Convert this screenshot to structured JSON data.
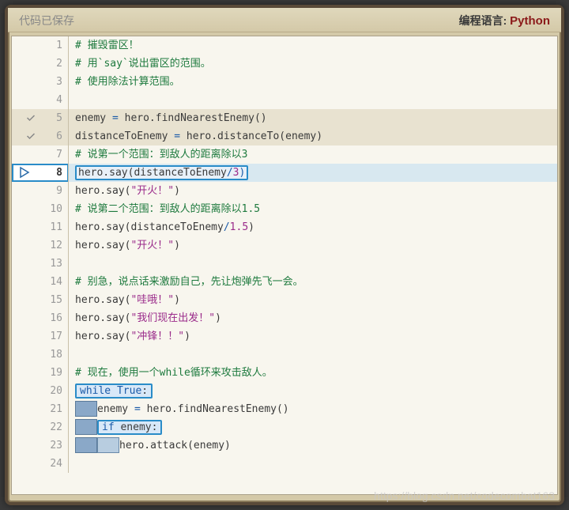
{
  "header": {
    "save_status": "代码已保存",
    "lang_label": "编程语言: ",
    "lang_value": "Python"
  },
  "lines": {
    "l1": "# 摧毁雷区！",
    "l2": "# 用`say`说出雷区的范围。",
    "l3": "# 使用除法计算范围。",
    "l5_a": "enemy ",
    "l5_b": "=",
    "l5_c": " hero.findNearestEnemy()",
    "l6_a": "distanceToEnemy ",
    "l6_b": "=",
    "l6_c": " hero.distanceTo(enemy)",
    "l7": "# 说第一个范围：到敌人的距离除以3",
    "l8_a": "hero.say(distanceToEnemy",
    "l8_b": "/",
    "l8_c": "3",
    "l8_d": ")",
    "l9_a": "hero.say(",
    "l9_b": "\"开火！\"",
    "l9_c": ")",
    "l10": "# 说第二个范围：到敌人的距离除以1.5",
    "l11_a": "hero.say(distanceToEnemy",
    "l11_b": "/",
    "l11_c": "1.5",
    "l11_d": ")",
    "l12_a": "hero.say(",
    "l12_b": "\"开火！\"",
    "l12_c": ")",
    "l14": "# 别急，说点话来激励自己，先让炮弹先飞一会。",
    "l15_a": "hero.say(",
    "l15_b": "\"哇哦！\"",
    "l15_c": ")",
    "l16_a": "hero.say(",
    "l16_b": "\"我们现在出发！\"",
    "l16_c": ")",
    "l17_a": "hero.say(",
    "l17_b": "\"冲锋！！\"",
    "l17_c": ")",
    "l19": "# 现在，使用一个while循环来攻击敌人。",
    "l20_a": "while",
    "l20_b": " True",
    "l20_c": ":",
    "l21_a": "enemy ",
    "l21_b": "=",
    "l21_c": " hero.findNearestEnemy()",
    "l22_a": "if",
    "l22_b": " enemy",
    "l22_c": ":",
    "l23": "hero.attack(enemy)"
  },
  "nums": {
    "n1": "1",
    "n2": "2",
    "n3": "3",
    "n4": "4",
    "n5": "5",
    "n6": "6",
    "n7": "7",
    "n8": "8",
    "n9": "9",
    "n10": "10",
    "n11": "11",
    "n12": "12",
    "n13": "13",
    "n14": "14",
    "n15": "15",
    "n16": "16",
    "n17": "17",
    "n18": "18",
    "n19": "19",
    "n20": "20",
    "n21": "21",
    "n22": "22",
    "n23": "23",
    "n24": "24"
  },
  "watermark": "https://blog.csdn.net/codecombat163"
}
